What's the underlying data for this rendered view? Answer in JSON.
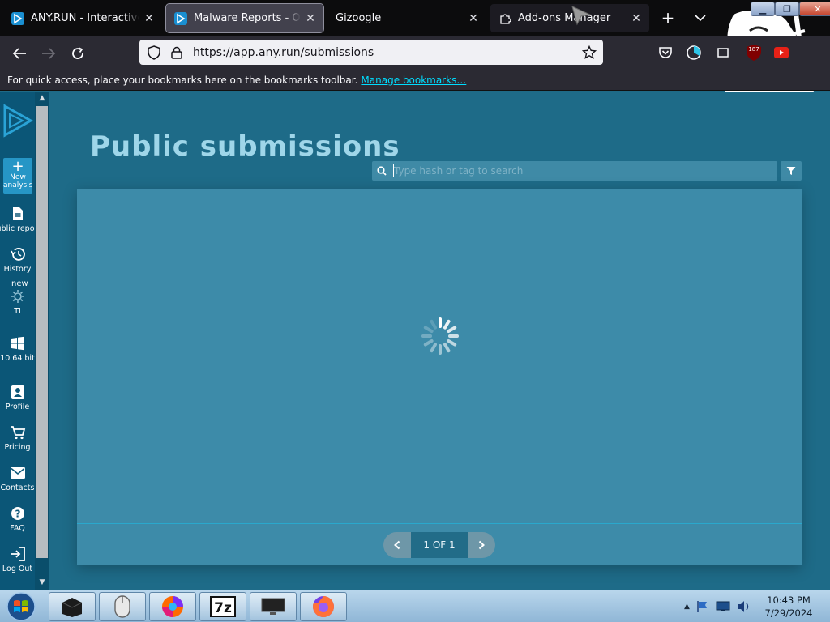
{
  "browser": {
    "tabs": [
      {
        "title": "ANY.RUN - Interactive Online",
        "state": "normal",
        "favicon": "anyrun-play-icon"
      },
      {
        "title": "Malware Reports - Online Malware",
        "state": "selected",
        "favicon": "anyrun-play-icon"
      },
      {
        "title": "Gizoogle",
        "state": "normal",
        "favicon": "none"
      },
      {
        "title": "Add-ons Manager",
        "state": "hover",
        "favicon": "puzzle-icon"
      }
    ],
    "url": "https://app.any.run/submissions",
    "bookmarks_message": "For quick access, place your bookmarks here on the bookmarks toolbar.",
    "bookmarks_link": "Manage bookmarks…",
    "extension_badge": "187"
  },
  "sidebar": {
    "new_analysis": "New analysis",
    "items": [
      {
        "label": "Public reports",
        "icon": "document-icon"
      },
      {
        "label": "History",
        "icon": "history-icon"
      },
      {
        "label": "TI",
        "icon": "ti-icon",
        "badge": "new"
      },
      {
        "label": "10 64 bit",
        "icon": "windows-icon"
      },
      {
        "label": "Profile",
        "icon": "profile-icon"
      },
      {
        "label": "Pricing",
        "icon": "cart-icon"
      },
      {
        "label": "Contacts",
        "icon": "mail-icon"
      },
      {
        "label": "FAQ",
        "icon": "help-icon"
      },
      {
        "label": "Log Out",
        "icon": "logout-icon"
      }
    ]
  },
  "main": {
    "title": "Public submissions",
    "search_placeholder": "Type hash or tag to search",
    "pagination": "1 OF 1"
  },
  "taskbar": {
    "time": "10:43 PM",
    "date": "7/29/2024"
  },
  "colors": {
    "accent": "#2696c6",
    "sidebar": "#0b5677",
    "content_bg": "#1e6b88",
    "panel": "#3d8ba9",
    "link": "#00ddff"
  }
}
